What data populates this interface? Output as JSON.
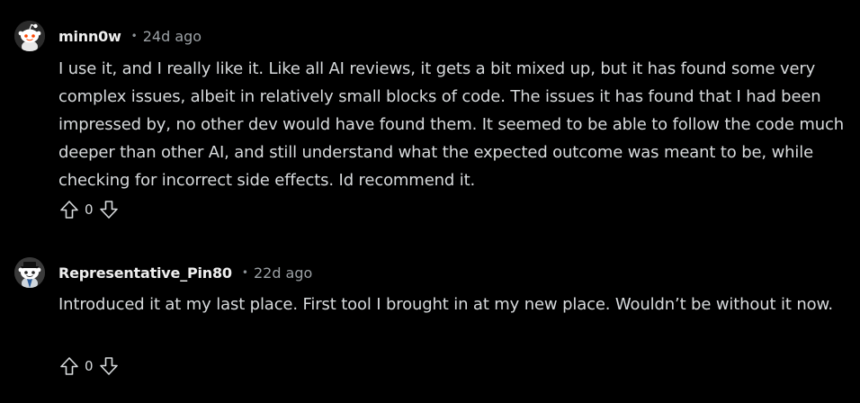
{
  "comments": [
    {
      "username": "minn0w",
      "separator": "•",
      "time": "24d ago",
      "avatar_icon": "snoo-avatar-icon",
      "text": "I use it, and I really like it. Like all AI reviews, it gets a bit mixed up, but it has found some very complex issues, albeit in relatively small blocks of code. The issues it has found that I had been impressed by, no other dev would have found them. It seemed to be able to follow the code much deeper than other AI, and still understand what the expected outcome was meant to be, while checking for incorrect side effects. Id recommend it.",
      "score": "0"
    },
    {
      "username": "Representative_Pin80",
      "separator": "•",
      "time": "22d ago",
      "avatar_icon": "snoo-avatar-icon",
      "text": "Introduced it at my last place. First tool I brought in at my new place. Wouldn’t be without it now.",
      "score": "0"
    }
  ],
  "icons": {
    "upvote": "upvote-arrow-icon",
    "downvote": "downvote-arrow-icon"
  },
  "colors": {
    "background": "#000000",
    "text": "#d7dadc",
    "meta": "#9ba0a4",
    "avatar_accent": "#ff4500"
  }
}
